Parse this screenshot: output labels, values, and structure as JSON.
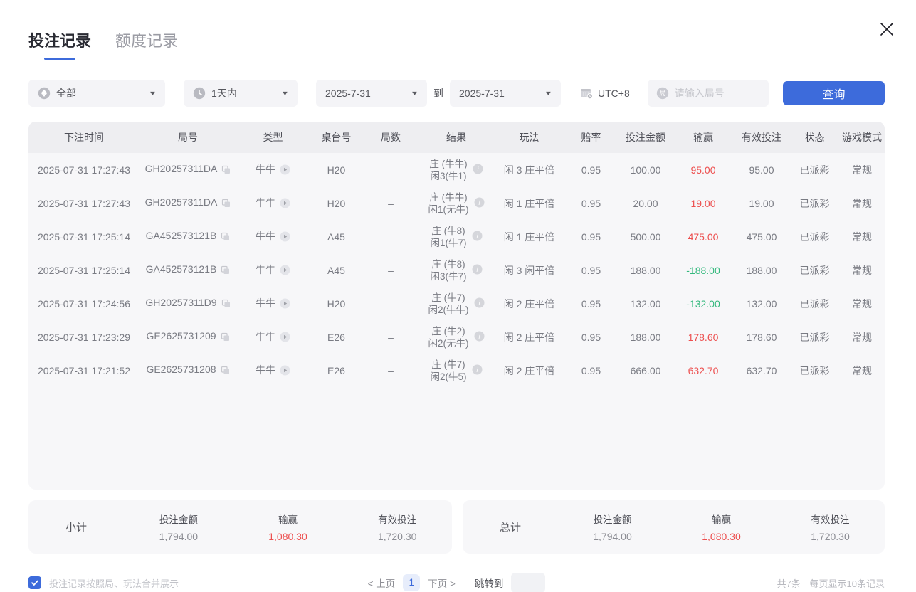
{
  "tabs": [
    {
      "label": "投注记录",
      "active": true
    },
    {
      "label": "额度记录",
      "active": false
    }
  ],
  "filters": {
    "game_type": {
      "value": "全部",
      "icon": "spade-icon"
    },
    "time_range": {
      "value": "1天内",
      "icon": "clock-icon"
    },
    "date_from": {
      "value": "2025-7-31"
    },
    "to_label": "到",
    "date_to": {
      "value": "2025-7-31"
    },
    "timezone": {
      "label": "UTC+8",
      "icon": "calendar-clock-icon"
    },
    "round_search": {
      "placeholder": "请输入局号",
      "icon": "round-badge-icon"
    },
    "query_button": "查询"
  },
  "table": {
    "headers": [
      "下注时间",
      "局号",
      "类型",
      "桌台号",
      "局数",
      "结果",
      "玩法",
      "赔率",
      "投注金额",
      "输赢",
      "有效投注",
      "状态",
      "游戏模式"
    ],
    "rows": [
      {
        "time": "2025-07-31 17:27:43",
        "round_id": "GH20257311DA",
        "type": "牛牛",
        "table_no": "H20",
        "rounds": "–",
        "result_line1": "庄 (牛牛)",
        "result_line2": "闲3(牛1)",
        "play": "闲 3 庄平倍",
        "odds": "0.95",
        "bet": "100.00",
        "win": "95.00",
        "win_color": "red",
        "valid": "95.00",
        "status": "已派彩",
        "mode": "常规"
      },
      {
        "time": "2025-07-31 17:27:43",
        "round_id": "GH20257311DA",
        "type": "牛牛",
        "table_no": "H20",
        "rounds": "–",
        "result_line1": "庄 (牛牛)",
        "result_line2": "闲1(无牛)",
        "play": "闲 1 庄平倍",
        "odds": "0.95",
        "bet": "20.00",
        "win": "19.00",
        "win_color": "red",
        "valid": "19.00",
        "status": "已派彩",
        "mode": "常规"
      },
      {
        "time": "2025-07-31 17:25:14",
        "round_id": "GA452573121B",
        "type": "牛牛",
        "table_no": "A45",
        "rounds": "–",
        "result_line1": "庄 (牛8)",
        "result_line2": "闲1(牛7)",
        "play": "闲 1 庄平倍",
        "odds": "0.95",
        "bet": "500.00",
        "win": "475.00",
        "win_color": "red",
        "valid": "475.00",
        "status": "已派彩",
        "mode": "常规"
      },
      {
        "time": "2025-07-31 17:25:14",
        "round_id": "GA452573121B",
        "type": "牛牛",
        "table_no": "A45",
        "rounds": "–",
        "result_line1": "庄 (牛8)",
        "result_line2": "闲3(牛7)",
        "play": "闲 3 闲平倍",
        "odds": "0.95",
        "bet": "188.00",
        "win": "-188.00",
        "win_color": "green",
        "valid": "188.00",
        "status": "已派彩",
        "mode": "常规"
      },
      {
        "time": "2025-07-31 17:24:56",
        "round_id": "GH20257311D9",
        "type": "牛牛",
        "table_no": "H20",
        "rounds": "–",
        "result_line1": "庄 (牛7)",
        "result_line2": "闲2(牛牛)",
        "play": "闲 2 庄平倍",
        "odds": "0.95",
        "bet": "132.00",
        "win": "-132.00",
        "win_color": "green",
        "valid": "132.00",
        "status": "已派彩",
        "mode": "常规"
      },
      {
        "time": "2025-07-31 17:23:29",
        "round_id": "GE2625731209",
        "type": "牛牛",
        "table_no": "E26",
        "rounds": "–",
        "result_line1": "庄 (牛2)",
        "result_line2": "闲2(无牛)",
        "play": "闲 2 庄平倍",
        "odds": "0.95",
        "bet": "188.00",
        "win": "178.60",
        "win_color": "red",
        "valid": "178.60",
        "status": "已派彩",
        "mode": "常规"
      },
      {
        "time": "2025-07-31 17:21:52",
        "round_id": "GE2625731208",
        "type": "牛牛",
        "table_no": "E26",
        "rounds": "–",
        "result_line1": "庄 (牛7)",
        "result_line2": "闲2(牛5)",
        "play": "闲 2 庄平倍",
        "odds": "0.95",
        "bet": "666.00",
        "win": "632.70",
        "win_color": "red",
        "valid": "632.70",
        "status": "已派彩",
        "mode": "常规"
      }
    ]
  },
  "summary": {
    "subtotal": {
      "label": "小计",
      "bet_label": "投注金额",
      "bet_value": "1,794.00",
      "win_label": "输赢",
      "win_value": "1,080.30",
      "valid_label": "有效投注",
      "valid_value": "1,720.30"
    },
    "total": {
      "label": "总计",
      "bet_label": "投注金额",
      "bet_value": "1,794.00",
      "win_label": "输赢",
      "win_value": "1,080.30",
      "valid_label": "有效投注",
      "valid_value": "1,720.30"
    }
  },
  "footer": {
    "merge_label": "投注记录按照局、玩法合并展示",
    "merge_checked": true,
    "prev_label": "< 上页",
    "current_page": "1",
    "next_label": "下页 >",
    "jump_label": "跳转到",
    "total_count": "共7条",
    "page_size": "每页显示10条记录"
  },
  "colors": {
    "accent": "#3d6bdb",
    "win_positive": "#ed5050",
    "win_negative": "#35b97e"
  }
}
